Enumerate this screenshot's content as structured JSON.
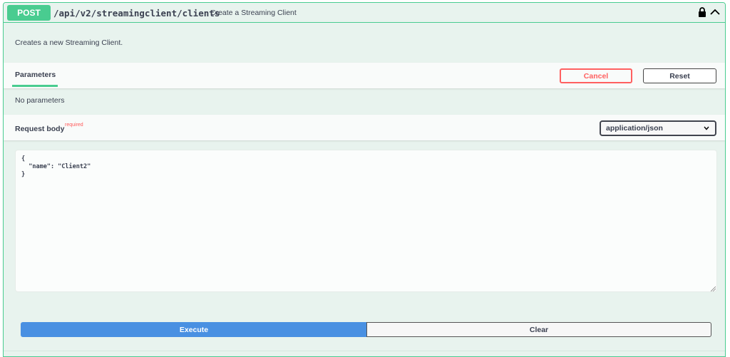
{
  "operation": {
    "method": "POST",
    "path": "/api/v2/streamingclient/clients",
    "summary": "Create a Streaming Client",
    "description": "Creates a new Streaming Client.",
    "icons": {
      "lock": "lock-icon",
      "collapse": "chevron-up-icon"
    }
  },
  "parameters": {
    "tab_label": "Parameters",
    "cancel_label": "Cancel",
    "reset_label": "Reset",
    "empty_text": "No parameters"
  },
  "request_body": {
    "title": "Request body",
    "required_label": "required",
    "content_type": "application/json",
    "body": "{\n  \"name\": \"Client2\"\n}"
  },
  "actions": {
    "execute_label": "Execute",
    "clear_label": "Clear"
  },
  "colors": {
    "post_accent": "#49cc90",
    "block_background": "#e8f3ee",
    "cancel": "#ff6060",
    "execute": "#4990e2"
  }
}
